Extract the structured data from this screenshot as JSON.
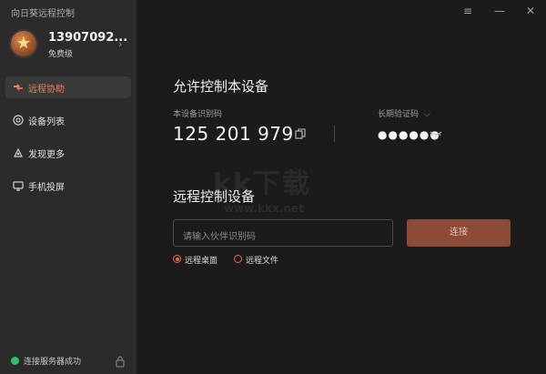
{
  "app": {
    "title": "向日葵远程控制"
  },
  "profile": {
    "phone": "13907092...",
    "tier": "免费级"
  },
  "nav": {
    "items": [
      {
        "label": "远程协助",
        "icon": "remote-assist-icon",
        "active": true
      },
      {
        "label": "设备列表",
        "icon": "device-list-icon",
        "active": false
      },
      {
        "label": "发现更多",
        "icon": "discover-icon",
        "active": false
      },
      {
        "label": "手机投屏",
        "icon": "screen-cast-icon",
        "active": false
      }
    ]
  },
  "status": {
    "text": "连接服务器成功",
    "color": "#29c26a"
  },
  "allow": {
    "heading": "允许控制本设备",
    "device_id_label": "本设备识别码",
    "device_id": "125 201 979",
    "password_label": "长期验证码",
    "password_masked": "●●●●●●"
  },
  "remote": {
    "heading": "远程控制设备",
    "input_placeholder": "请输入伙伴识别码",
    "connect_label": "连接",
    "options": [
      {
        "label": "远程桌面",
        "selected": true
      },
      {
        "label": "远程文件",
        "selected": false
      }
    ]
  },
  "watermark": {
    "main": "kk下载",
    "sub": "www.kkx.net"
  },
  "colors": {
    "accent": "#ff7b52",
    "connect_bg": "#8c4a37",
    "sidebar_bg": "#2b2b2b",
    "main_bg": "#1b1b1b"
  }
}
